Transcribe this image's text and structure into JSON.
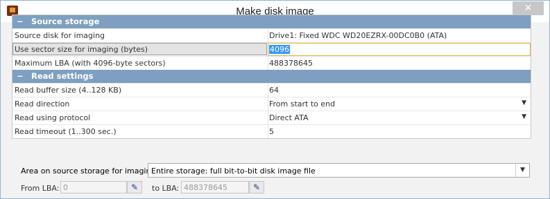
{
  "window": {
    "title": "Make disk image",
    "close_glyph": "✕",
    "app_icon": "ufs-app-icon"
  },
  "sections": [
    {
      "label": "Source storage",
      "toggle": "−",
      "rows": [
        {
          "name": "Source disk for imaging",
          "value": "Drive1: Fixed WDC WD20EZRX-00DC0B0 (ATA)"
        },
        {
          "name": "Use sector size for imaging (bytes)",
          "value": "4096",
          "selected": true
        },
        {
          "name": "Maximum LBA (with 4096-byte sectors)",
          "value": "488378645"
        }
      ]
    },
    {
      "label": "Read settings",
      "toggle": "−",
      "rows": [
        {
          "name": "Read buffer size (4..128 KB)",
          "value": "64"
        },
        {
          "name": "Read direction",
          "value": "From start to end",
          "dropdown": true
        },
        {
          "name": "Read using protocol",
          "value": "Direct ATA",
          "dropdown": true
        },
        {
          "name": "Read timeout (1..300 sec.)",
          "value": "5"
        }
      ]
    }
  ],
  "area": {
    "label": "Area on source storage for imaging:",
    "value": "Entire storage: full bit-to-bit disk image file",
    "dropdown_glyph": "▼"
  },
  "from_lba": {
    "label": "From LBA:",
    "value": "0"
  },
  "to_lba": {
    "label": "to LBA:",
    "value": "488378645"
  },
  "dropdown_glyph": "▼",
  "edit_icon_glyph": "✎"
}
